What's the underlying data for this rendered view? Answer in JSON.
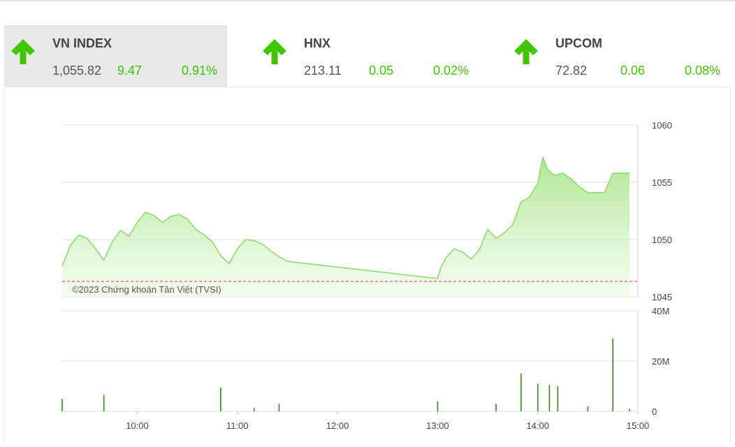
{
  "indices": [
    {
      "name": "VN INDEX",
      "price": "1,055.82",
      "change": "9.47",
      "percent": "0.91%",
      "direction": "up-arrow-icon",
      "active": true
    },
    {
      "name": "HNX",
      "price": "213.11",
      "change": "0.05",
      "percent": "0.02%",
      "direction": "up-arrow-icon",
      "active": false
    },
    {
      "name": "UPCOM",
      "price": "72.82",
      "change": "0.06",
      "percent": "0.08%",
      "direction": "up-arrow-icon",
      "active": false
    }
  ],
  "colors": {
    "up": "#3ec700",
    "line": "#8fdc6a",
    "volume": "#2e8b1e",
    "reference": "#e53935"
  },
  "chart_data": [
    {
      "type": "area",
      "ylim": [
        1045,
        1060
      ],
      "y_ticks": [
        "1060",
        "1055",
        "1050",
        "1045"
      ],
      "reference_value": 1046.35,
      "watermark": "©2023 Chứng khoán Tân Việt (TVSI)",
      "x_range": [
        "09:15",
        "15:00"
      ],
      "series": [
        {
          "values": [
            [
              "09:15",
              1047.7
            ],
            [
              "09:20",
              1049.5
            ],
            [
              "09:25",
              1050.4
            ],
            [
              "09:30",
              1050.1
            ],
            [
              "09:35",
              1049.2
            ],
            [
              "09:40",
              1048.2
            ],
            [
              "09:45",
              1049.8
            ],
            [
              "09:50",
              1050.8
            ],
            [
              "09:55",
              1050.3
            ],
            [
              "10:00",
              1051.5
            ],
            [
              "10:05",
              1052.4
            ],
            [
              "10:10",
              1052.1
            ],
            [
              "10:15",
              1051.5
            ],
            [
              "10:20",
              1052.0
            ],
            [
              "10:25",
              1052.2
            ],
            [
              "10:30",
              1051.8
            ],
            [
              "10:35",
              1050.9
            ],
            [
              "10:40",
              1050.4
            ],
            [
              "10:45",
              1049.8
            ],
            [
              "10:50",
              1048.6
            ],
            [
              "10:55",
              1047.9
            ],
            [
              "11:00",
              1049.2
            ],
            [
              "11:05",
              1050.0
            ],
            [
              "11:10",
              1049.9
            ],
            [
              "11:15",
              1049.6
            ],
            [
              "11:20",
              1049.0
            ],
            [
              "11:25",
              1048.5
            ],
            [
              "11:30",
              1048.1
            ],
            [
              "13:00",
              1046.6
            ],
            [
              "13:02",
              1047.6
            ],
            [
              "13:05",
              1048.4
            ],
            [
              "13:10",
              1049.2
            ],
            [
              "13:15",
              1048.9
            ],
            [
              "13:20",
              1048.3
            ],
            [
              "13:25",
              1049.1
            ],
            [
              "13:30",
              1050.9
            ],
            [
              "13:35",
              1050.1
            ],
            [
              "13:40",
              1050.6
            ],
            [
              "13:45",
              1051.3
            ],
            [
              "13:50",
              1053.3
            ],
            [
              "13:55",
              1053.7
            ],
            [
              "14:00",
              1054.9
            ],
            [
              "14:03",
              1057.2
            ],
            [
              "14:06",
              1056.1
            ],
            [
              "14:10",
              1055.6
            ],
            [
              "14:15",
              1055.8
            ],
            [
              "14:20",
              1055.3
            ],
            [
              "14:25",
              1054.6
            ],
            [
              "14:30",
              1054.1
            ],
            [
              "14:40",
              1054.1
            ],
            [
              "14:45",
              1055.8
            ],
            [
              "14:55",
              1055.8
            ]
          ]
        }
      ]
    },
    {
      "type": "bar",
      "ylim": [
        0,
        40
      ],
      "y_ticks": [
        "40M",
        "20M",
        "0"
      ],
      "x_ticks": [
        "10:00",
        "11:00",
        "12:00",
        "13:00",
        "14:00",
        "15:00"
      ],
      "series": [
        {
          "values": [
            [
              "09:15",
              5
            ],
            [
              "09:40",
              6.5
            ],
            [
              "10:50",
              9.5
            ],
            [
              "11:10",
              1.5
            ],
            [
              "11:25",
              3
            ],
            [
              "13:00",
              4
            ],
            [
              "13:35",
              3
            ],
            [
              "13:50",
              15
            ],
            [
              "14:00",
              11
            ],
            [
              "14:07",
              10.5
            ],
            [
              "14:12",
              10
            ],
            [
              "14:30",
              2
            ],
            [
              "14:45",
              29
            ],
            [
              "14:55",
              1
            ]
          ]
        }
      ]
    }
  ]
}
